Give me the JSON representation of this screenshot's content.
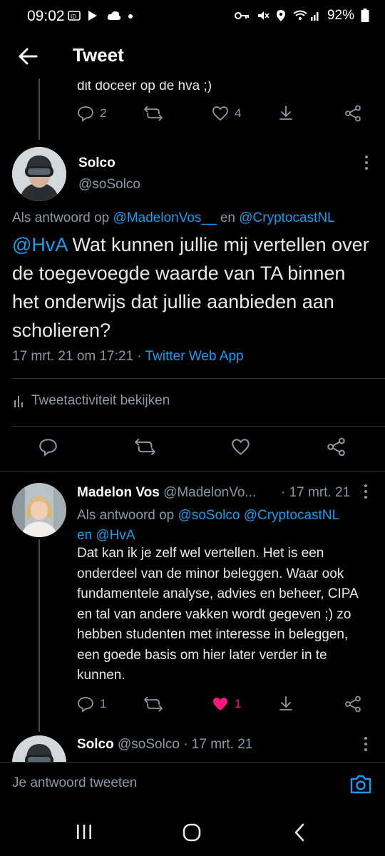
{
  "status_bar": {
    "time": "09:02",
    "battery": "92%"
  },
  "header": {
    "title": "Tweet"
  },
  "previous_tweet": {
    "partial_text": "dit doceer op de hva ;)",
    "reply_count": "2",
    "like_count": "4"
  },
  "main_tweet": {
    "display_name": "Solco",
    "handle": "@soSolco",
    "reply_prefix": "Als antwoord op",
    "reply_user_1": "@MadelonVos__",
    "reply_and": "en",
    "reply_user_2": "@CryptocastNL",
    "mention": "@HvA",
    "body": " Wat kunnen jullie mij vertellen over de toegevoegde waarde van TA binnen het onderwijs dat jullie aanbieden aan scholieren?",
    "datetime": "17 mrt. 21 om 17:21",
    "separator": "·",
    "source": "Twitter Web App",
    "activity_label": "Tweetactiviteit bekijken"
  },
  "reply_tweet": {
    "display_name": "Madelon Vos",
    "handle": "@MadelonVo...",
    "date": "· 17 mrt. 21",
    "reply_prefix": "Als antwoord op",
    "reply_user_1": "@soSolco",
    "reply_user_2": "@CryptocastNL",
    "reply_and": "en",
    "reply_user_3": "@HvA",
    "body": "Dat kan ik je zelf wel vertellen. Het is een onderdeel van de minor beleggen. Waar ook fundamentele analyse, advies en beheer, CIPA en tal van andere vakken wordt gegeven ;) zo hebben studenten met interesse in beleggen, een goede basis om hier later verder in te kunnen.",
    "reply_count": "1",
    "like_count": "1",
    "liked": true
  },
  "next_tweet": {
    "display_name": "Solco",
    "handle": "@soSolco",
    "date": "· 17 mrt. 21"
  },
  "composer": {
    "placeholder": "Je antwoord tweeten"
  },
  "colors": {
    "background": "#000000",
    "text": "#e7e9ea",
    "muted": "#8b98a5",
    "accent": "#1d9bf0",
    "like": "#f91880",
    "divider": "#2f3336"
  },
  "icons": [
    "back-arrow-icon",
    "reply-icon",
    "retweet-icon",
    "like-icon",
    "share-down-icon",
    "share-icon",
    "more-icon",
    "analytics-icon",
    "camera-icon"
  ]
}
